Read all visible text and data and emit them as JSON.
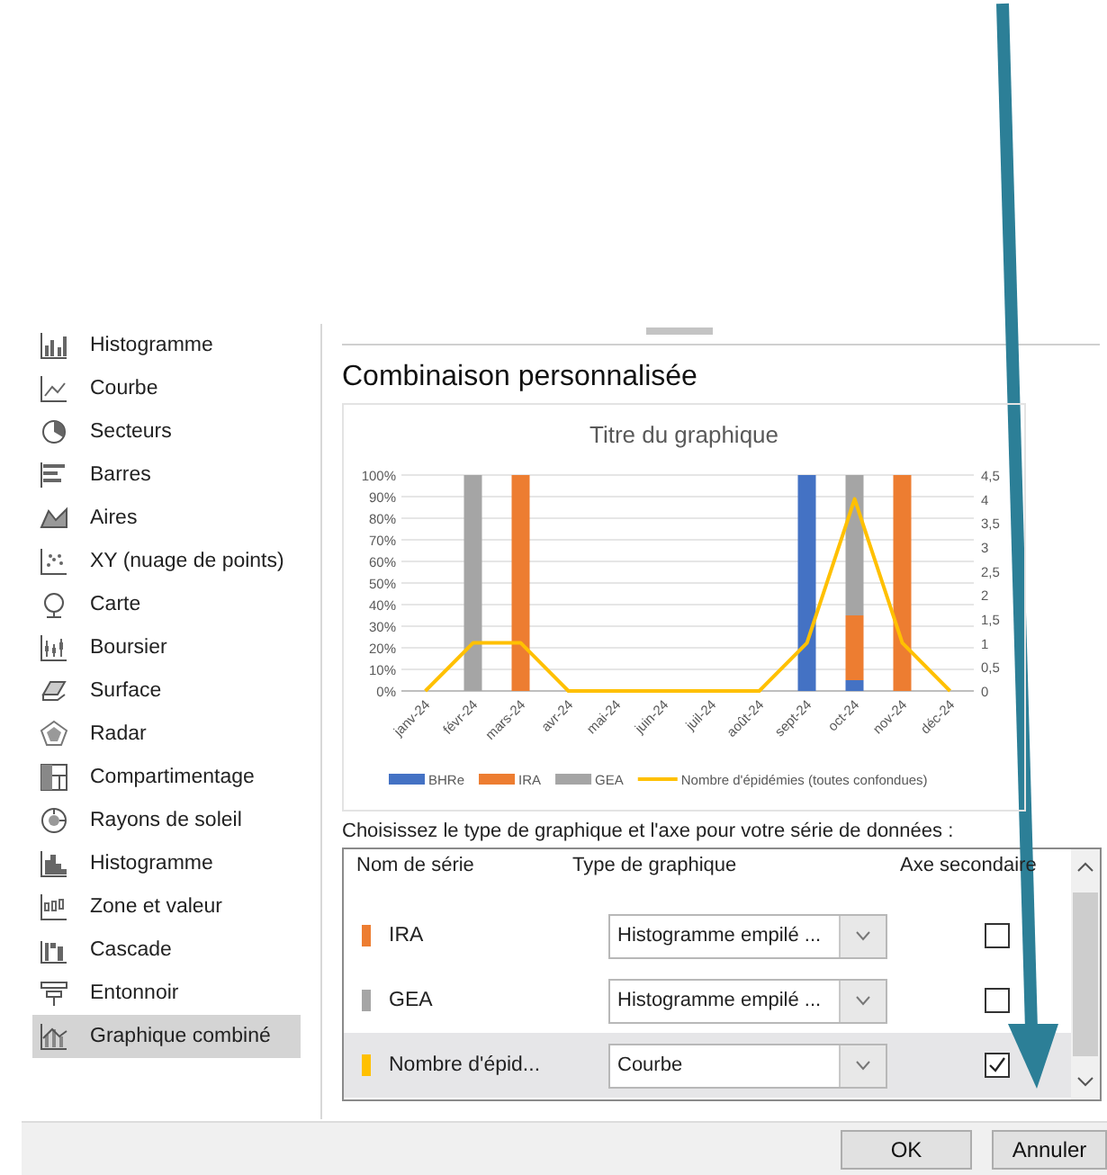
{
  "sidebar": {
    "items": [
      {
        "label": "Histogramme",
        "selected": false
      },
      {
        "label": "Courbe",
        "selected": false
      },
      {
        "label": "Secteurs",
        "selected": false
      },
      {
        "label": "Barres",
        "selected": false
      },
      {
        "label": "Aires",
        "selected": false
      },
      {
        "label": "XY (nuage de points)",
        "selected": false
      },
      {
        "label": "Carte",
        "selected": false
      },
      {
        "label": "Boursier",
        "selected": false
      },
      {
        "label": "Surface",
        "selected": false
      },
      {
        "label": "Radar",
        "selected": false
      },
      {
        "label": "Compartimentage",
        "selected": false
      },
      {
        "label": "Rayons de soleil",
        "selected": false
      },
      {
        "label": "Histogramme",
        "selected": false
      },
      {
        "label": "Zone et valeur",
        "selected": false
      },
      {
        "label": "Cascade",
        "selected": false
      },
      {
        "label": "Entonnoir",
        "selected": false
      },
      {
        "label": "Graphique combiné",
        "selected": true
      }
    ]
  },
  "panel": {
    "title": "Combinaison personnalisée",
    "chart_data": {
      "type": "bar",
      "stacked": true,
      "title": "Titre du graphique",
      "categories": [
        "janv-24",
        "févr-24",
        "mars-24",
        "avr-24",
        "mai-24",
        "juin-24",
        "juil-24",
        "août-24",
        "sept-24",
        "oct-24",
        "nov-24",
        "déc-24"
      ],
      "series": [
        {
          "name": "BHRe",
          "color": "#4472c4",
          "type": "bar",
          "values": [
            0,
            0,
            0,
            0,
            0,
            0,
            0,
            0,
            100,
            5,
            0,
            0
          ]
        },
        {
          "name": "IRA",
          "color": "#ed7d31",
          "type": "bar",
          "values": [
            0,
            0,
            100,
            0,
            0,
            0,
            0,
            0,
            0,
            30,
            100,
            0
          ]
        },
        {
          "name": "GEA",
          "color": "#a5a5a5",
          "type": "bar",
          "values": [
            0,
            100,
            0,
            0,
            0,
            0,
            0,
            0,
            0,
            65,
            0,
            0
          ]
        },
        {
          "name": "Nombre d'épidémies (toutes confondues)",
          "color": "#ffc000",
          "type": "line",
          "axis": "y2",
          "values": [
            0,
            1,
            1,
            0,
            0,
            0,
            0,
            0,
            1,
            4,
            1,
            0
          ]
        }
      ],
      "grid": true,
      "legend": "bottom",
      "ylim": [
        0,
        100
      ],
      "yticks": [
        {
          "value": 0,
          "label": "0%"
        },
        {
          "value": 10,
          "label": "10%"
        },
        {
          "value": 20,
          "label": "20%"
        },
        {
          "value": 30,
          "label": "30%"
        },
        {
          "value": 40,
          "label": "40%"
        },
        {
          "value": 50,
          "label": "50%"
        },
        {
          "value": 60,
          "label": "60%"
        },
        {
          "value": 70,
          "label": "70%"
        },
        {
          "value": 80,
          "label": "80%"
        },
        {
          "value": 90,
          "label": "90%"
        },
        {
          "value": 100,
          "label": "100%"
        }
      ],
      "y2lim": [
        0,
        4.5
      ],
      "y2ticks": [
        {
          "value": 0,
          "label": "0"
        },
        {
          "value": 0.5,
          "label": "0,5"
        },
        {
          "value": 1,
          "label": "1"
        },
        {
          "value": 1.5,
          "label": "1,5"
        },
        {
          "value": 2,
          "label": "2"
        },
        {
          "value": 2.5,
          "label": "2,5"
        },
        {
          "value": 3,
          "label": "3"
        },
        {
          "value": 3.5,
          "label": "3,5"
        },
        {
          "value": 4,
          "label": "4"
        },
        {
          "value": 4.5,
          "label": "4,5"
        }
      ]
    },
    "series_prompt": "Choisissez le type de graphique et l'axe pour votre série de données :",
    "series_table": {
      "columns": [
        "Nom de série",
        "Type de graphique",
        "Axe secondaire"
      ],
      "rows": [
        {
          "name": "IRA",
          "color": "#ed7d31",
          "chart_type": "Histogramme empilé ...",
          "secondary_axis": false,
          "selected": false
        },
        {
          "name": "GEA",
          "color": "#a5a5a5",
          "chart_type": "Histogramme empilé ...",
          "secondary_axis": false,
          "selected": false
        },
        {
          "name": "Nombre d'épid...",
          "color": "#ffc000",
          "chart_type": "Courbe",
          "secondary_axis": true,
          "selected": true
        }
      ]
    }
  },
  "buttons": [
    "OK",
    "Annuler"
  ]
}
